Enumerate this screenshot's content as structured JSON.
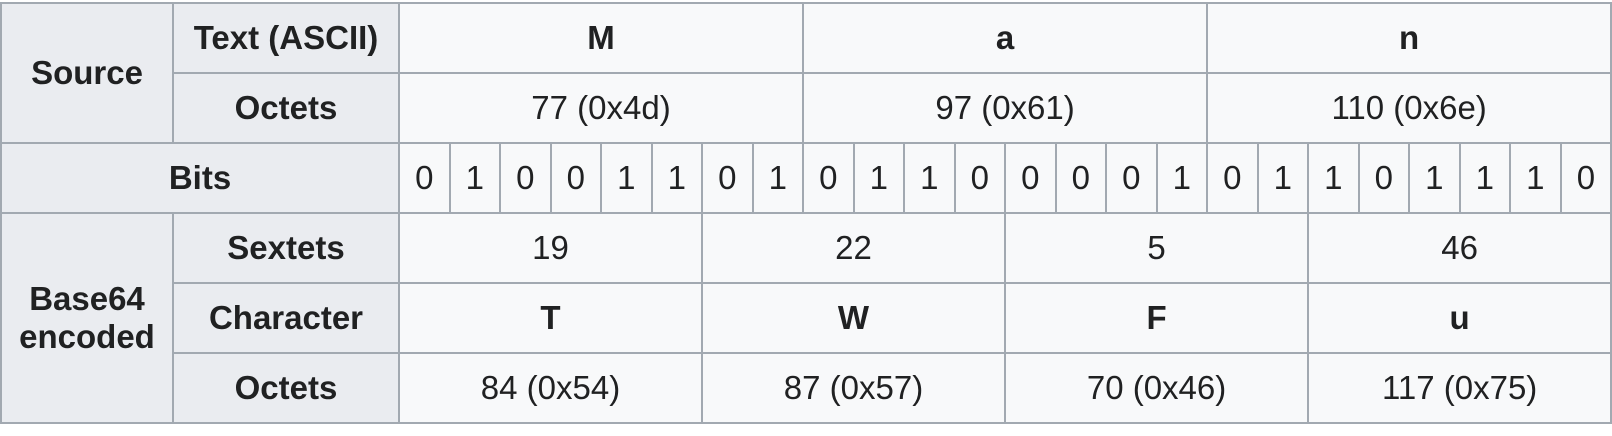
{
  "source_label": "Source",
  "text_ascii_label": "Text (ASCII)",
  "octets_label": "Octets",
  "bits_label": "Bits",
  "base64_label": "Base64 encoded",
  "sextets_label": "Sextets",
  "character_label": "Character",
  "source_chars": [
    "M",
    "a",
    "n"
  ],
  "source_octets": [
    "77 (0x4d)",
    "97 (0x61)",
    "110 (0x6e)"
  ],
  "bits": [
    "0",
    "1",
    "0",
    "0",
    "1",
    "1",
    "0",
    "1",
    "0",
    "1",
    "1",
    "0",
    "0",
    "0",
    "0",
    "1",
    "0",
    "1",
    "1",
    "0",
    "1",
    "1",
    "1",
    "0"
  ],
  "sextets": [
    "19",
    "22",
    "5",
    "46"
  ],
  "base64_chars": [
    "T",
    "W",
    "F",
    "u"
  ],
  "base64_octets": [
    "84 (0x54)",
    "87 (0x57)",
    "70 (0x46)",
    "117 (0x75)"
  ]
}
